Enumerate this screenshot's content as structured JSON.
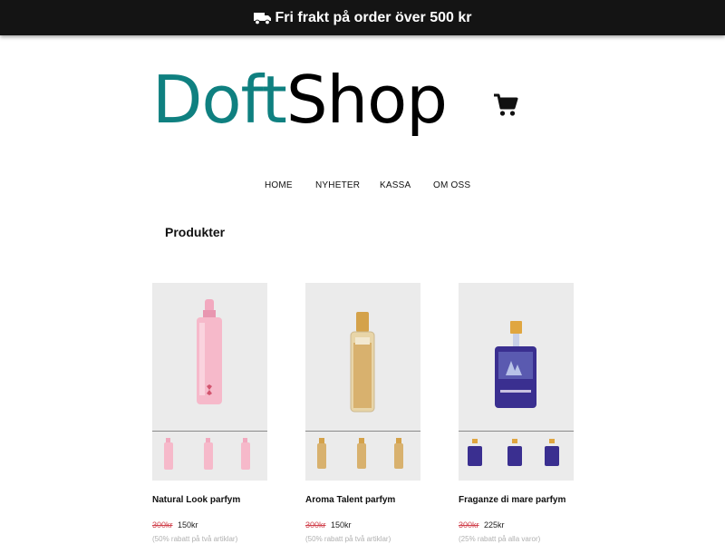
{
  "banner": {
    "icon": "truck-icon",
    "text": "Fri frakt på order över 500 kr"
  },
  "logo": {
    "part1": "Doft",
    "part2": "Shop"
  },
  "colors": {
    "brand": "#0f8080",
    "banner_bg": "#141414",
    "old_price": "#d0404b",
    "note": "#b0b0b0"
  },
  "cart": {
    "icon": "cart-icon"
  },
  "nav": {
    "items": [
      "HOME",
      "NYHETER",
      "KASSA",
      "OM OSS"
    ]
  },
  "section": {
    "title": "Produkter"
  },
  "products": [
    {
      "name": "Natural Look parfym",
      "old_price": "300kr",
      "price": "150kr",
      "note": "(50% rabatt på två artiklar)"
    },
    {
      "name": "Aroma Talent parfym",
      "old_price": "300kr",
      "price": "150kr",
      "note": "(50% rabatt på två artiklar)"
    },
    {
      "name": "Fraganze di mare parfym",
      "old_price": "300kr",
      "price": "225kr",
      "note": "(25% rabatt på alla varor)"
    }
  ]
}
